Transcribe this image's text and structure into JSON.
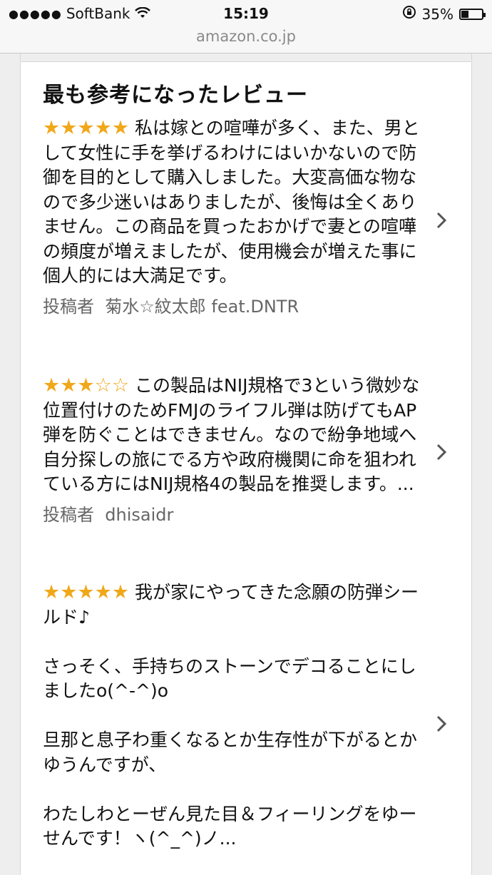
{
  "status_bar": {
    "carrier": "SoftBank",
    "time": "15:19",
    "battery_percent": "35%",
    "battery_level": 0.35
  },
  "browser": {
    "url": "amazon.co.jp"
  },
  "section": {
    "title": "最も参考になったレビュー"
  },
  "reviews": [
    {
      "rating": 5,
      "stars_filled": "★★★★★",
      "stars_empty": "",
      "text": "私は嫁との喧嘩が多く、また、男として女性に手を挙げるわけにはいかないので防御を目的として購入しました。大変高価な物なので多少迷いはありましたが、後悔は全くありません。この商品を買ったおかげで妻との喧嘩の頻度が増えましたが、使用機会が増えた事に個人的には大満足です。",
      "author_prefix": "投稿者",
      "author": "菊水☆紋太郎 feat.DNTR"
    },
    {
      "rating": 3,
      "stars_filled": "★★★",
      "stars_empty": "☆☆",
      "text": "この製品はNIJ規格で3という微妙な位置付けのためFMJのライフル弾は防げてもAP弾を防ぐことはできません。なので紛争地域へ自分探しの旅にでる方や政府機関に命を狙われている方にはNIJ規格4の製品を推奨します。...",
      "author_prefix": "投稿者",
      "author": "dhisaidr"
    },
    {
      "rating": 5,
      "stars_filled": "★★★★★",
      "stars_empty": "",
      "text": "我が家にやってきた念願の防弾シールド♪\n\nさっそく、手持ちのストーンでデコることにしましたo(^-^)o\n\n旦那と息子わ重くなるとか生存性が下がるとかゆうんですが、\n\nわたしわとーぜん見た目＆フィーリングをゆーせんです！ヽ(^_^)ノ..."
    }
  ]
}
